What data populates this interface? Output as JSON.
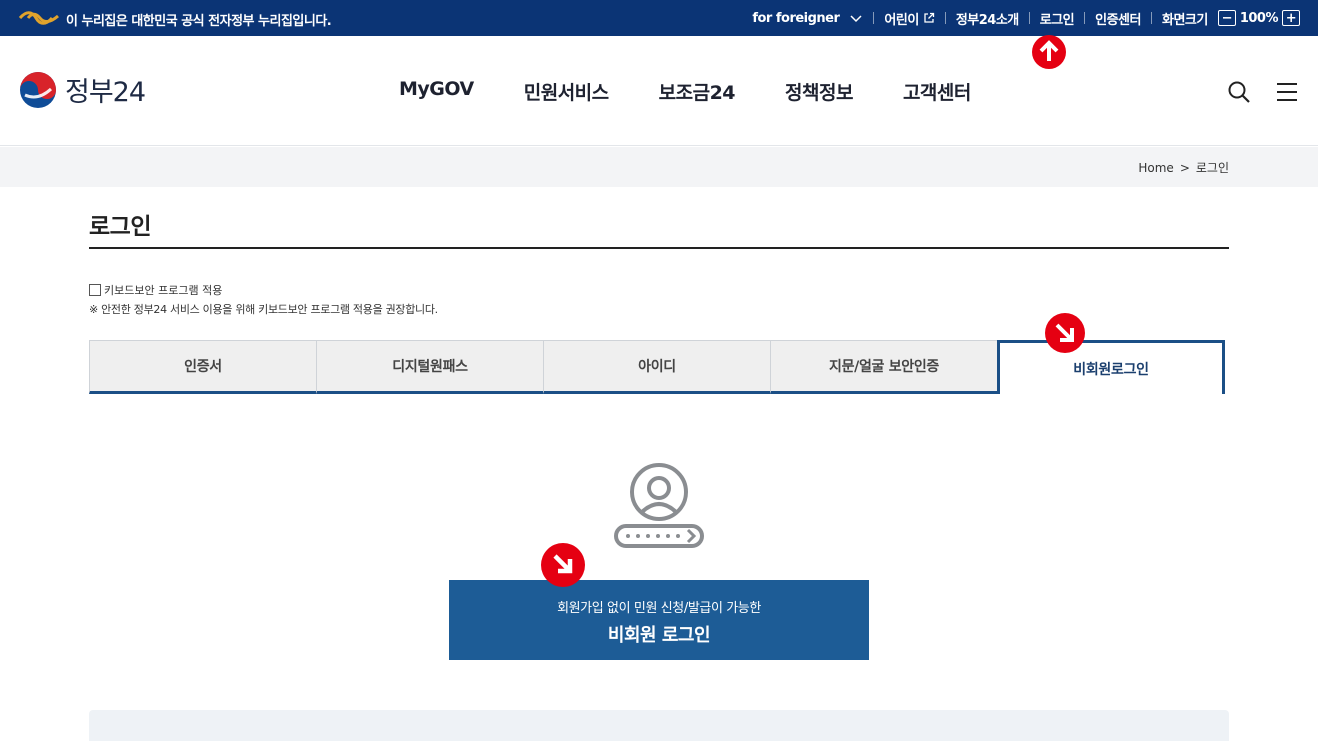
{
  "topbar": {
    "notice": "이 누리집은 대한민국 공식 전자정부 누리집입니다.",
    "links": {
      "foreigner": "for foreigner",
      "kids": "어린이",
      "about": "정부24소개",
      "login": "로그인",
      "cert": "인증센터",
      "screen_size": "화면크기",
      "zoom_minus": "−",
      "zoom_level": "100%",
      "zoom_plus": "+"
    }
  },
  "header": {
    "logo_text": "정부24",
    "nav": [
      "MyGOV",
      "민원서비스",
      "보조금24",
      "정책정보",
      "고객센터"
    ],
    "icons": [
      "search-icon",
      "menu-icon"
    ]
  },
  "breadcrumb": {
    "home": "Home",
    "sep": ">",
    "current": "로그인"
  },
  "page": {
    "title": "로그인",
    "keyboard_checkbox_label": "키보드보안 프로그램 적용",
    "keyboard_note": "※ 안전한 정부24 서비스 이용을 위해 키보드보안 프로그램 적용을 권장합니다."
  },
  "tabs": [
    {
      "label": "인증서",
      "active": false
    },
    {
      "label": "디지털원패스",
      "active": false
    },
    {
      "label": "아이디",
      "active": false
    },
    {
      "label": "지문/얼굴 보안인증",
      "active": false
    },
    {
      "label": "비회원로그인",
      "active": true
    }
  ],
  "guest_login": {
    "sub_label": "회원가입 없이 민원 신청/발급이 가능한",
    "main_label": "비회원 로그인"
  },
  "colors": {
    "topbar_bg": "#0b3475",
    "accent": "#1b4f86",
    "button_bg": "#1d5c96",
    "marker_red": "#e50012"
  }
}
